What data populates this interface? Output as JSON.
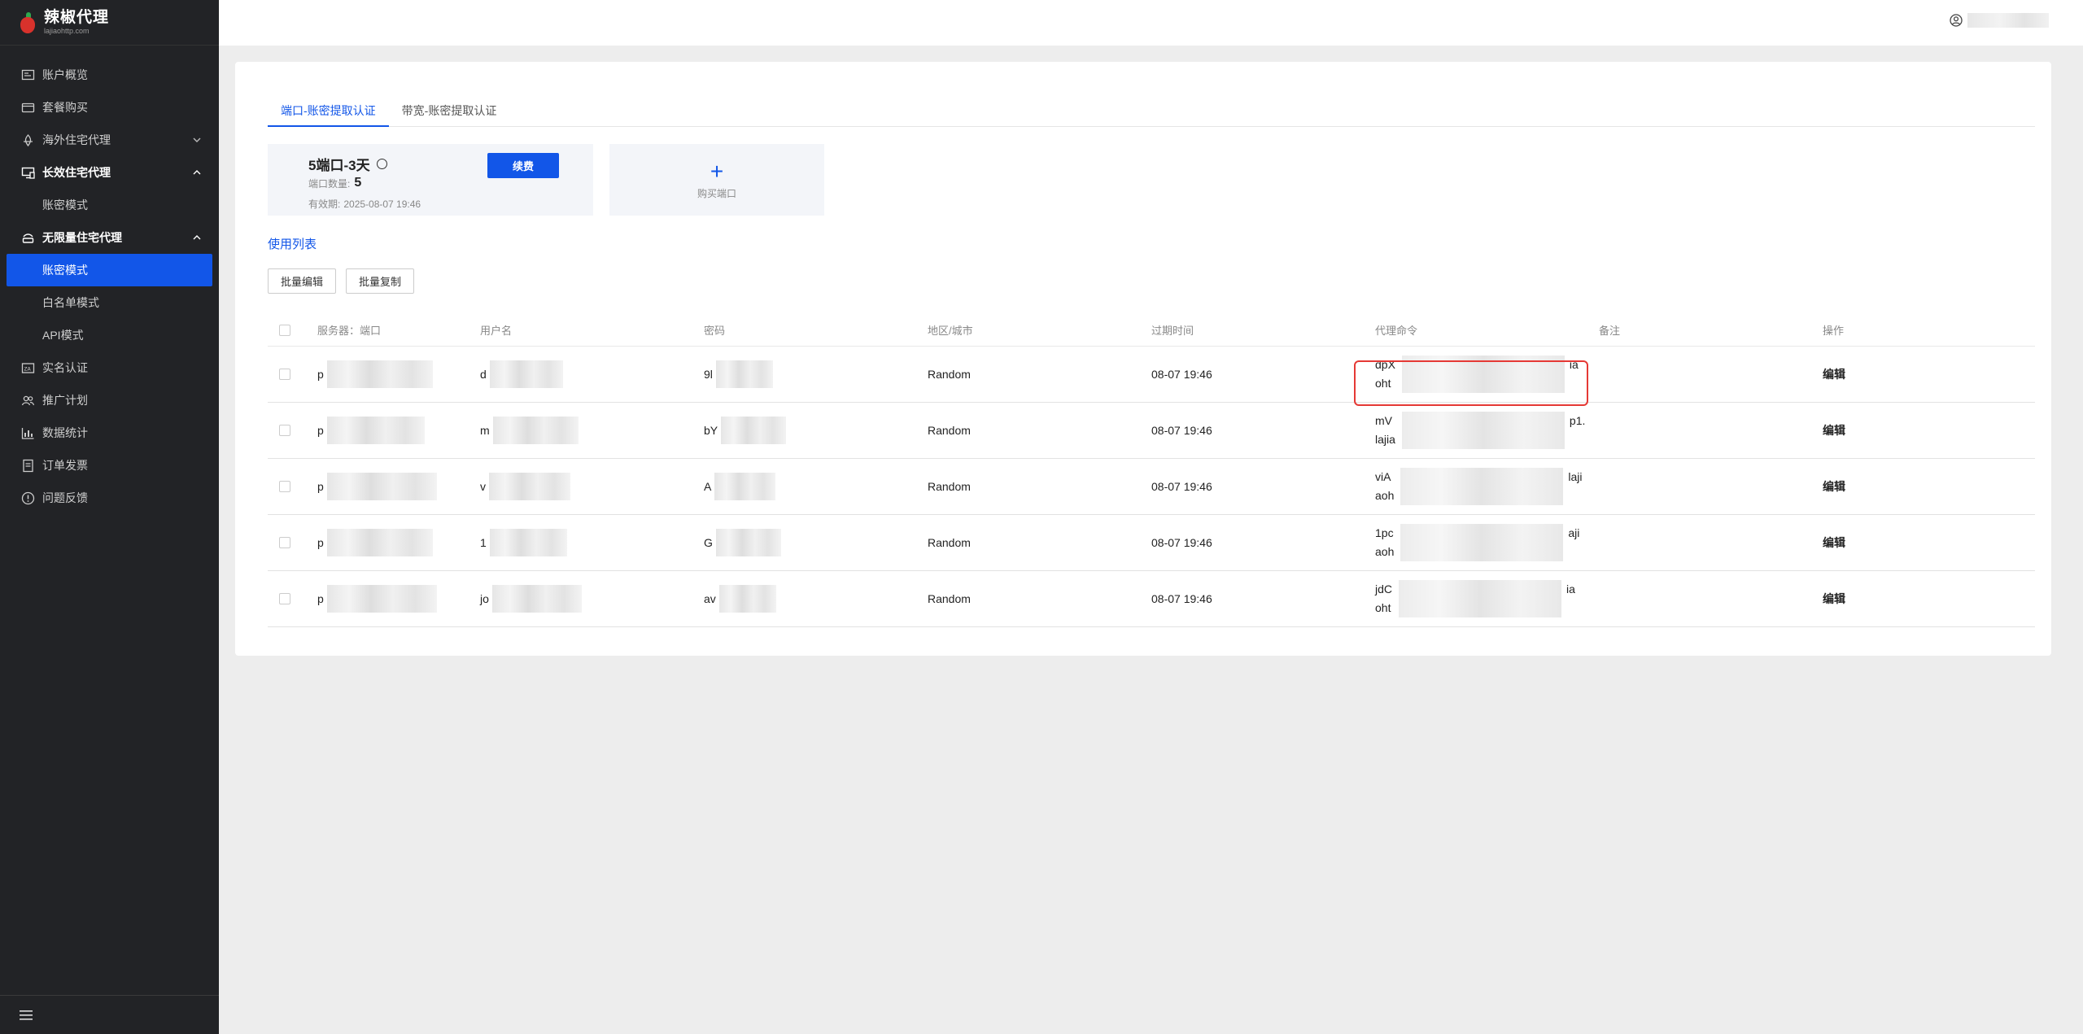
{
  "brand": {
    "title": "辣椒代理",
    "subtitle": "lajiaohttp.com"
  },
  "sidebar": {
    "items": [
      {
        "label": "账户概览",
        "icon": "dashboard-icon"
      },
      {
        "label": "套餐购买",
        "icon": "wallet-icon"
      },
      {
        "label": "海外住宅代理",
        "icon": "globe-icon",
        "chevron": "down"
      },
      {
        "label": "长效住宅代理",
        "icon": "monitor-icon",
        "chevron": "up",
        "bold": true
      },
      {
        "label": "账密模式",
        "sub": true
      },
      {
        "label": "无限量住宅代理",
        "icon": "router-icon",
        "chevron": "up",
        "bold": true
      },
      {
        "label": "账密模式",
        "sub": true,
        "active": true
      },
      {
        "label": "白名单模式",
        "sub": true
      },
      {
        "label": "API模式",
        "sub": true
      },
      {
        "label": "实名认证",
        "icon": "id-card-icon"
      },
      {
        "label": "推广计划",
        "icon": "users-icon"
      },
      {
        "label": "数据统计",
        "icon": "chart-icon"
      },
      {
        "label": "订单发票",
        "icon": "invoice-icon"
      },
      {
        "label": "问题反馈",
        "icon": "feedback-icon"
      }
    ]
  },
  "tabs": [
    {
      "label": "端口-账密提取认证",
      "active": true
    },
    {
      "label": "带宽-账密提取认证",
      "active": false
    }
  ],
  "plan": {
    "title": "5端口-3天",
    "count_label": "端口数量:",
    "count_value": "5",
    "expiry_label": "有效期:",
    "expiry_value": "2025-08-07 19:46",
    "renew_label": "续费"
  },
  "buy_port": {
    "label": "购买端口"
  },
  "list_title": "使用列表",
  "actions": {
    "batch_edit": "批量编辑",
    "batch_copy": "批量复制"
  },
  "table": {
    "headers": [
      "服务器：端口",
      "用户名",
      "密码",
      "地区/城市",
      "过期时间",
      "代理命令",
      "备注",
      "操作"
    ],
    "rows": [
      {
        "server": "p",
        "user": "d",
        "pass": "9l",
        "region": "Random",
        "expire": "08-07 19:46",
        "cmd1": "dpX",
        "cmd1_end": "ia",
        "cmd2": "oht",
        "edit": "编辑",
        "highlight": true
      },
      {
        "server": "p",
        "user": "m",
        "pass": "bY",
        "region": "Random",
        "expire": "08-07 19:46",
        "cmd1": "mV",
        "cmd1_end": "p1.",
        "cmd2": "lajia",
        "edit": "编辑"
      },
      {
        "server": "p",
        "user": "v",
        "pass": "A",
        "region": "Random",
        "expire": "08-07 19:46",
        "cmd1": "viA",
        "cmd1_end": "laji",
        "cmd2": "aoh",
        "edit": "编辑"
      },
      {
        "server": "p",
        "user": "1",
        "pass": "G",
        "region": "Random",
        "expire": "08-07 19:46",
        "cmd1": "1pc",
        "cmd1_end": "aji",
        "cmd2": "aoh",
        "edit": "编辑"
      },
      {
        "server": "p",
        "user": "jo",
        "pass": "av",
        "region": "Random",
        "expire": "08-07 19:46",
        "cmd1": "jdC",
        "cmd1_end": "ia",
        "cmd2": "oht",
        "edit": "编辑"
      }
    ]
  },
  "colors": {
    "accent": "#1256e8",
    "sidebar_bg": "#222326",
    "highlight": "#e53935"
  }
}
